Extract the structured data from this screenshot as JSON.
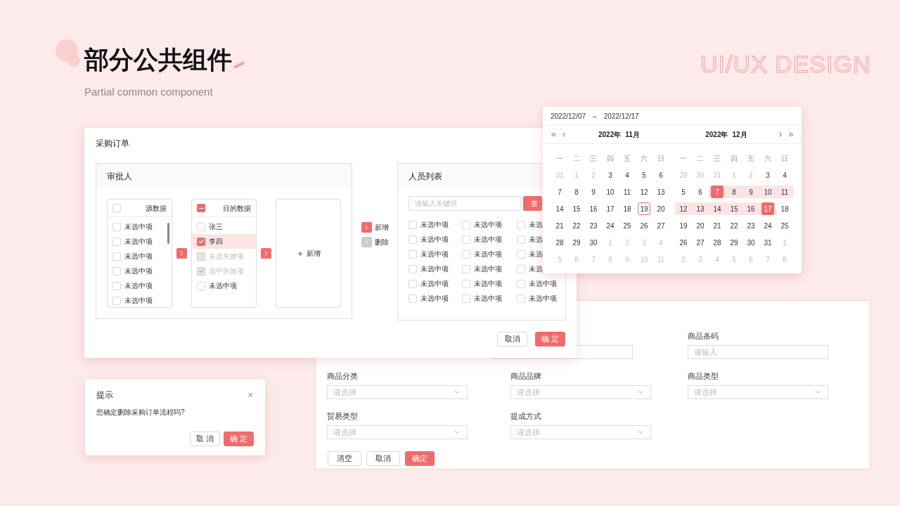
{
  "header": {
    "title": "部分公共组件",
    "subtitle": "Partial common component",
    "brand": "UI/UX DESIGN"
  },
  "order_dialog": {
    "title": "采购订单",
    "approver_panel": {
      "title": "审批人",
      "source": {
        "title": "源数据",
        "checked": false,
        "items": [
          {
            "label": "未选中项",
            "checked": false
          },
          {
            "label": "未选中项",
            "checked": false
          },
          {
            "label": "未选中项",
            "checked": false
          },
          {
            "label": "未选中项",
            "checked": false
          },
          {
            "label": "未选中项",
            "checked": false
          },
          {
            "label": "未选中项",
            "checked": false
          }
        ]
      },
      "target": {
        "title": "目的数据",
        "indeterminate": true,
        "items": [
          {
            "label": "张三",
            "checked": false,
            "disabled": false,
            "selected": false
          },
          {
            "label": "李四",
            "checked": true,
            "disabled": false,
            "selected": true
          },
          {
            "label": "未选失效项",
            "checked": false,
            "disabled": true,
            "selected": false
          },
          {
            "label": "选中失效项",
            "checked": true,
            "disabled": true,
            "selected": false
          },
          {
            "label": "未选中项",
            "checked": false,
            "disabled": false,
            "selected": false
          }
        ]
      },
      "add_label": "新增"
    },
    "move_buttons": [
      {
        "label": "新增",
        "disabled": false
      },
      {
        "label": "删除",
        "disabled": true
      }
    ],
    "personnel_panel": {
      "title": "人员列表",
      "search_placeholder": "请输入关键词",
      "search_button": "查",
      "items": [
        {
          "label": "未选中项",
          "checked": false
        },
        {
          "label": "未选中项",
          "checked": false
        },
        {
          "label": "未选",
          "checked": false
        },
        {
          "label": "未选中项",
          "checked": false
        },
        {
          "label": "未选中项",
          "checked": false
        },
        {
          "label": "未选",
          "checked": false
        },
        {
          "label": "未选中项",
          "checked": false
        },
        {
          "label": "未选中项",
          "checked": false
        },
        {
          "label": "未选",
          "checked": false
        },
        {
          "label": "未选中项",
          "checked": false
        },
        {
          "label": "未选中项",
          "checked": false
        },
        {
          "label": "未选",
          "checked": false
        },
        {
          "label": "未选中项",
          "checked": false
        },
        {
          "label": "未选中项",
          "checked": false
        },
        {
          "label": "未选中项",
          "checked": false
        },
        {
          "label": "未选中项",
          "checked": false
        },
        {
          "label": "未选中项",
          "checked": false
        },
        {
          "label": "未选中项",
          "checked": false
        }
      ]
    },
    "buttons": [
      {
        "label": "取消",
        "kind": "default"
      },
      {
        "label": "确 定",
        "kind": "primary"
      }
    ]
  },
  "calendar": {
    "start": "2022/12/07",
    "separator": "–",
    "end": "2022/12/17",
    "months": [
      {
        "year": "2022年",
        "month": "11月",
        "weekdays": [
          "一",
          "二",
          "三",
          "四",
          "五",
          "六",
          "日"
        ],
        "days": [
          {
            "label": "31",
            "kind": "muted"
          },
          {
            "label": "1",
            "kind": "muted"
          },
          {
            "label": "2",
            "kind": "muted"
          },
          {
            "label": "3",
            "kind": "normal"
          },
          {
            "label": "4",
            "kind": "normal"
          },
          {
            "label": "5",
            "kind": "normal"
          },
          {
            "label": "6",
            "kind": "normal"
          },
          {
            "label": "7",
            "kind": "normal"
          },
          {
            "label": "8",
            "kind": "normal"
          },
          {
            "label": "9",
            "kind": "normal"
          },
          {
            "label": "10",
            "kind": "normal"
          },
          {
            "label": "11",
            "kind": "normal"
          },
          {
            "label": "12",
            "kind": "normal"
          },
          {
            "label": "13",
            "kind": "normal"
          },
          {
            "label": "14",
            "kind": "normal"
          },
          {
            "label": "15",
            "kind": "normal"
          },
          {
            "label": "16",
            "kind": "normal"
          },
          {
            "label": "17",
            "kind": "normal"
          },
          {
            "label": "18",
            "kind": "normal"
          },
          {
            "label": "19",
            "kind": "today"
          },
          {
            "label": "20",
            "kind": "normal"
          },
          {
            "label": "21",
            "kind": "normal"
          },
          {
            "label": "22",
            "kind": "normal"
          },
          {
            "label": "23",
            "kind": "normal"
          },
          {
            "label": "24",
            "kind": "normal"
          },
          {
            "label": "25",
            "kind": "normal"
          },
          {
            "label": "26",
            "kind": "normal"
          },
          {
            "label": "27",
            "kind": "normal"
          },
          {
            "label": "28",
            "kind": "normal"
          },
          {
            "label": "29",
            "kind": "normal"
          },
          {
            "label": "30",
            "kind": "normal"
          },
          {
            "label": "1",
            "kind": "muted"
          },
          {
            "label": "2",
            "kind": "muted"
          },
          {
            "label": "3",
            "kind": "muted"
          },
          {
            "label": "4",
            "kind": "muted"
          },
          {
            "label": "5",
            "kind": "muted"
          },
          {
            "label": "6",
            "kind": "muted"
          },
          {
            "label": "7",
            "kind": "muted"
          },
          {
            "label": "8",
            "kind": "muted"
          },
          {
            "label": "9",
            "kind": "muted"
          },
          {
            "label": "10",
            "kind": "muted"
          },
          {
            "label": "11",
            "kind": "muted"
          }
        ]
      },
      {
        "year": "2022年",
        "month": "12月",
        "weekdays": [
          "一",
          "二",
          "三",
          "四",
          "五",
          "六",
          "日"
        ],
        "days": [
          {
            "label": "29",
            "kind": "muted"
          },
          {
            "label": "30",
            "kind": "muted"
          },
          {
            "label": "31",
            "kind": "muted"
          },
          {
            "label": "1",
            "kind": "muted"
          },
          {
            "label": "2",
            "kind": "muted"
          },
          {
            "label": "3",
            "kind": "normal"
          },
          {
            "label": "4",
            "kind": "normal"
          },
          {
            "label": "5",
            "kind": "normal"
          },
          {
            "label": "6",
            "kind": "normal"
          },
          {
            "label": "7",
            "kind": "start"
          },
          {
            "label": "8",
            "kind": "range"
          },
          {
            "label": "9",
            "kind": "range"
          },
          {
            "label": "10",
            "kind": "range"
          },
          {
            "label": "11",
            "kind": "range"
          },
          {
            "label": "12",
            "kind": "range"
          },
          {
            "label": "13",
            "kind": "range"
          },
          {
            "label": "14",
            "kind": "range"
          },
          {
            "label": "15",
            "kind": "range"
          },
          {
            "label": "16",
            "kind": "range"
          },
          {
            "label": "17",
            "kind": "end"
          },
          {
            "label": "18",
            "kind": "normal"
          },
          {
            "label": "19",
            "kind": "normal"
          },
          {
            "label": "20",
            "kind": "normal"
          },
          {
            "label": "21",
            "kind": "normal"
          },
          {
            "label": "22",
            "kind": "normal"
          },
          {
            "label": "23",
            "kind": "normal"
          },
          {
            "label": "24",
            "kind": "normal"
          },
          {
            "label": "25",
            "kind": "normal"
          },
          {
            "label": "26",
            "kind": "normal"
          },
          {
            "label": "27",
            "kind": "normal"
          },
          {
            "label": "28",
            "kind": "normal"
          },
          {
            "label": "29",
            "kind": "normal"
          },
          {
            "label": "30",
            "kind": "normal"
          },
          {
            "label": "31",
            "kind": "normal"
          },
          {
            "label": "1",
            "kind": "muted"
          },
          {
            "label": "2",
            "kind": "muted"
          },
          {
            "label": "3",
            "kind": "muted"
          },
          {
            "label": "4",
            "kind": "muted"
          },
          {
            "label": "5",
            "kind": "muted"
          },
          {
            "label": "6",
            "kind": "muted"
          },
          {
            "label": "7",
            "kind": "muted"
          },
          {
            "label": "8",
            "kind": "muted"
          }
        ]
      }
    ]
  },
  "filter_form": {
    "first_row_fields": [
      {
        "label": "商品条码",
        "placeholder": "请输入",
        "kind": "input"
      }
    ],
    "rows": [
      [
        {
          "label": "商品分类",
          "placeholder": "请选择",
          "kind": "select"
        },
        {
          "label": "商品品牌",
          "placeholder": "请选择",
          "kind": "select"
        },
        {
          "label": "商品类型",
          "placeholder": "请选择",
          "kind": "select"
        }
      ],
      [
        {
          "label": "贸易类型",
          "placeholder": "请选择",
          "kind": "select"
        },
        {
          "label": "提成方式",
          "placeholder": "请选择",
          "kind": "select"
        }
      ]
    ],
    "buttons": [
      {
        "label": "清空",
        "kind": "default"
      },
      {
        "label": "取消",
        "kind": "default"
      },
      {
        "label": "确定",
        "kind": "primary"
      }
    ]
  },
  "prompt": {
    "title": "提示",
    "message": "您确定删除采购订单流程吗?",
    "buttons": [
      {
        "label": "取 消",
        "kind": "default"
      },
      {
        "label": "确 定",
        "kind": "primary"
      }
    ]
  }
}
